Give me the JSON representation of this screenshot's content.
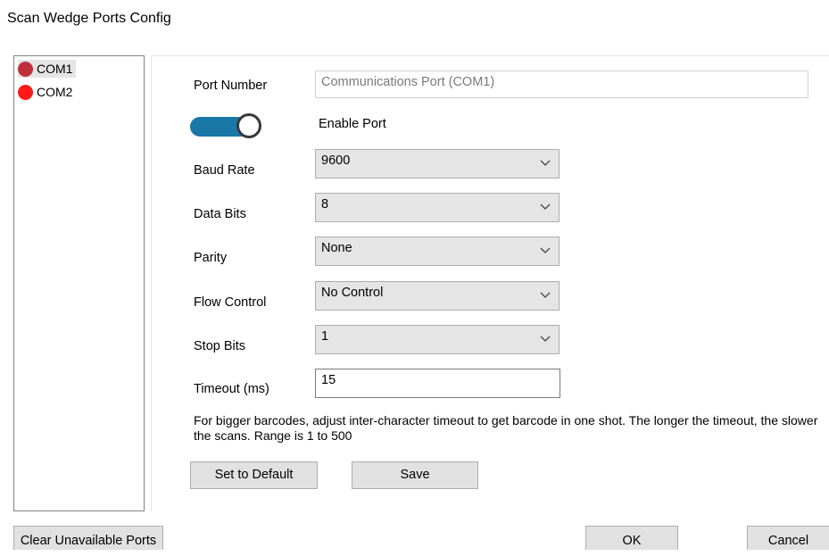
{
  "window": {
    "title": "Scan Wedge Ports Config"
  },
  "ports": [
    {
      "label": "COM1",
      "status_color": "#c0303c",
      "selected": true
    },
    {
      "label": "COM2",
      "status_color": "#ff1a1a",
      "selected": false
    }
  ],
  "form": {
    "port_number_label": "Port Number",
    "port_number_value": "Communications Port (COM1)",
    "enable_port_label": "Enable Port",
    "enable_port_on": true,
    "baud_rate_label": "Baud Rate",
    "baud_rate_value": "9600",
    "data_bits_label": "Data Bits",
    "data_bits_value": "8",
    "parity_label": "Parity",
    "parity_value": "None",
    "flow_control_label": "Flow Control",
    "flow_control_value": "No Control",
    "stop_bits_label": "Stop Bits",
    "stop_bits_value": "1",
    "timeout_label": "Timeout (ms)",
    "timeout_value": "15",
    "hint_text": "For bigger barcodes, adjust inter-character timeout to get barcode in one shot. The longer the timeout, the slower the scans. Range is 1 to 500",
    "set_default_label": "Set to Default",
    "save_label": "Save"
  },
  "footer": {
    "clear_label": "Clear Unavailable Ports",
    "ok_label": "OK",
    "cancel_label": "Cancel"
  },
  "colors": {
    "toggle_on": "#1a78a8",
    "button_face": "#e1e1e1"
  },
  "icons": {
    "dropdown": "chevron-down-icon",
    "port_status": "status-dot-icon"
  }
}
